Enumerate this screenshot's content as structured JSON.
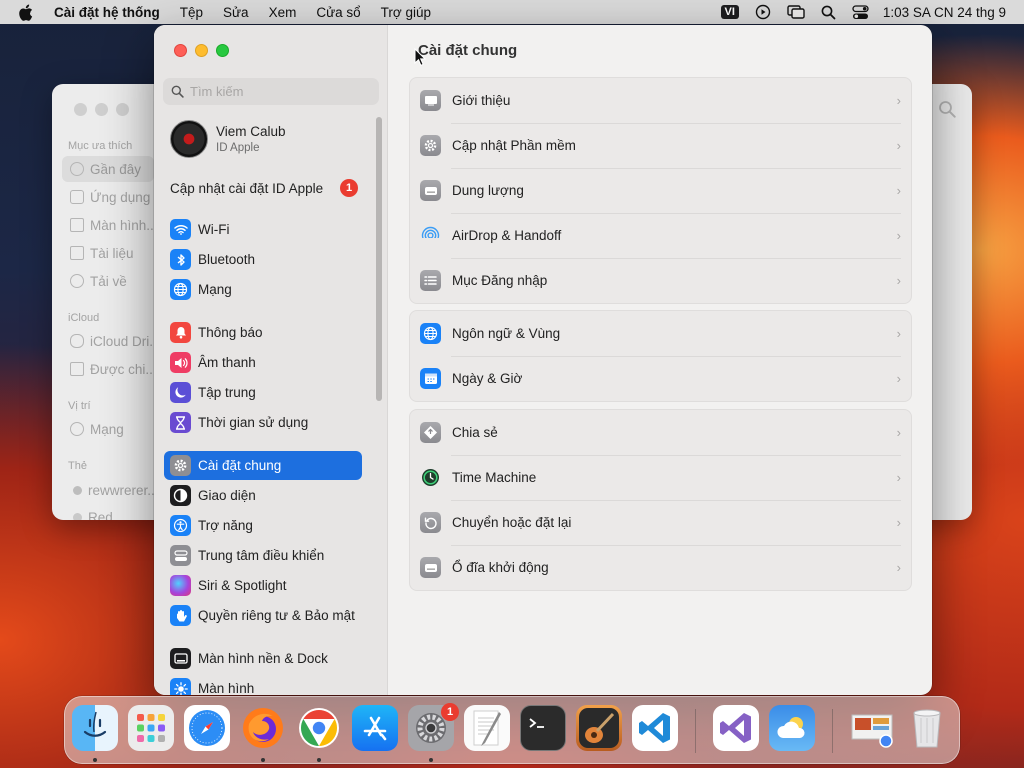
{
  "menubar": {
    "app_name": "Cài đặt hệ thống",
    "menus": [
      "Tệp",
      "Sửa",
      "Xem",
      "Cửa sổ",
      "Trợ giúp"
    ],
    "input_source": "VI",
    "clock": "1:03 SA CN 24 thg 9"
  },
  "finder": {
    "sections": {
      "favorites": "Mục ưa thích",
      "icloud": "iCloud",
      "locations": "Vị trí",
      "tags": "Thẻ"
    },
    "items": [
      "Gần đây",
      "Ứng dụng",
      "Màn hình...",
      "Tài liệu",
      "Tải về",
      "iCloud Dri...",
      "Được chi...",
      "Mạng",
      "rewwrerer...",
      "Red"
    ]
  },
  "sidebar": {
    "search_placeholder": "Tìm kiếm",
    "profile_name": "Viem Calub",
    "profile_sub": "ID Apple",
    "appleid_update": "Cập nhật cài đặt ID Apple",
    "appleid_badge": "1",
    "items": [
      {
        "label": "Wi-Fi",
        "icon": "wifi-icon",
        "color": "#1a82f7"
      },
      {
        "label": "Bluetooth",
        "icon": "bluetooth-icon",
        "color": "#1a82f7"
      },
      {
        "label": "Mạng",
        "icon": "globe-icon",
        "color": "#1a82f7"
      },
      {
        "label": "Thông báo",
        "icon": "bell-icon",
        "color": "#f2473f"
      },
      {
        "label": "Âm thanh",
        "icon": "speaker-icon",
        "color": "#ef3d64"
      },
      {
        "label": "Tập trung",
        "icon": "moon-icon",
        "color": "#5b4fd6"
      },
      {
        "label": "Thời gian sử dụng",
        "icon": "hourglass-icon",
        "color": "#6a4bd1"
      },
      {
        "label": "Cài đặt chung",
        "icon": "gear-icon",
        "color": "#8e8e93"
      },
      {
        "label": "Giao diện",
        "icon": "appearance-icon",
        "color": "#1d1d1f"
      },
      {
        "label": "Trợ năng",
        "icon": "accessibility-icon",
        "color": "#1a82f7"
      },
      {
        "label": "Trung tâm điều khiển",
        "icon": "control-center-icon",
        "color": "#8e8e93"
      },
      {
        "label": "Siri & Spotlight",
        "icon": "siri-icon",
        "color": "#9b47d6"
      },
      {
        "label": "Quyền riêng tư & Bảo mật",
        "icon": "hand-icon",
        "color": "#1a82f7"
      },
      {
        "label": "Màn hình nền & Dock",
        "icon": "dock-icon",
        "color": "#1d1d1f"
      },
      {
        "label": "Màn hình",
        "icon": "sun-icon",
        "color": "#1a82f7"
      }
    ]
  },
  "content": {
    "title": "Cài đặt chung",
    "groups": [
      [
        {
          "label": "Giới thiệu",
          "icon": "about-icon"
        },
        {
          "label": "Cập nhật Phần mềm",
          "icon": "software-update-icon"
        },
        {
          "label": "Dung lượng",
          "icon": "storage-icon"
        },
        {
          "label": "AirDrop & Handoff",
          "icon": "airdrop-icon"
        },
        {
          "label": "Mục Đăng nhập",
          "icon": "login-items-icon"
        }
      ],
      [
        {
          "label": "Ngôn ngữ & Vùng",
          "icon": "language-icon"
        },
        {
          "label": "Ngày & Giờ",
          "icon": "calendar-icon"
        }
      ],
      [
        {
          "label": "Chia sẻ",
          "icon": "sharing-icon"
        },
        {
          "label": "Time Machine",
          "icon": "time-machine-icon"
        },
        {
          "label": "Chuyển hoặc đặt lại",
          "icon": "reset-icon"
        },
        {
          "label": "Ổ đĩa khởi động",
          "icon": "startup-disk-icon"
        }
      ]
    ]
  },
  "dock": {
    "apps": [
      "Finder",
      "Launchpad",
      "Safari",
      "Firefox",
      "Chrome",
      "App Store",
      "System Settings",
      "TextEdit",
      "Terminal",
      "GarageBand",
      "Visual Studio Code",
      "Visual Studio",
      "Weather",
      "Downloads",
      "Trash"
    ],
    "settings_badge": "1"
  }
}
